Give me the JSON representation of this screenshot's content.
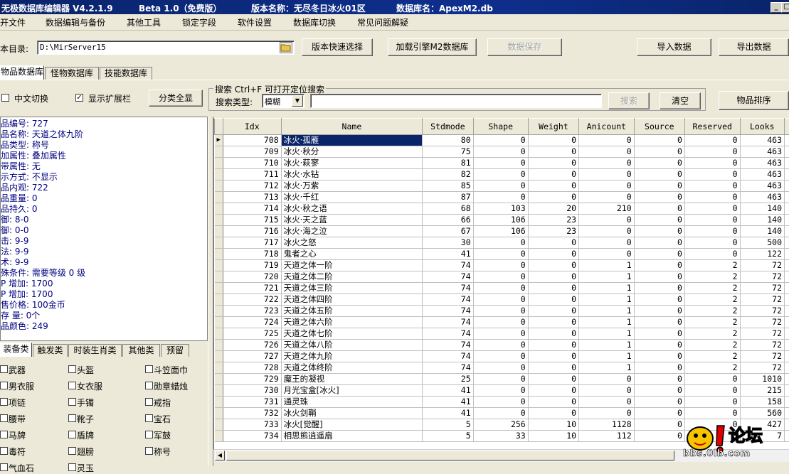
{
  "window": {
    "app_title": "无极数据库编辑器 V4.2.1.9",
    "edition": "Beta 1.0（免费版）",
    "version_name": "版本名称：无尽冬日冰火01区",
    "db_name": "数据库名：ApexM2.db"
  },
  "menu": [
    "开文件",
    "数据编辑与备份",
    "其他工具",
    "锁定字段",
    "软件设置",
    "数据库切换",
    "常见问题解疑"
  ],
  "toolbar": {
    "dir_label": "本目录:",
    "dir_value": "D:\\MirServer15",
    "quick_select": "版本快速选择",
    "load_db": "加载引擎M2数据库",
    "save_data": "数据保存",
    "import_data": "导入数据",
    "export_data": "导出数据"
  },
  "tabs": [
    "物品数据库",
    "怪物数据库",
    "技能数据库"
  ],
  "options": {
    "chinese_switch": "中文切换",
    "show_ext": "显示扩展栏",
    "category_all": "分类全显"
  },
  "search": {
    "group_title": "搜索  Ctrl+F 可打开定位搜索",
    "type_label": "搜索类型:",
    "type_value": "模糊",
    "search_btn": "搜索",
    "clear_btn": "清空",
    "sort_btn": "物品排序"
  },
  "info_lines": [
    "品编号: 727",
    "品名称: 天道之体九阶",
    "品类型: 称号",
    "加属性: 叠加属性",
    "带属性: 无",
    "示方式: 不显示",
    "品内观: 722",
    "品重量: 0",
    "品持久: 0",
    "    御: 8-0",
    "    御: 0-0",
    "    击: 9-9",
    "    法: 9-9",
    "    术: 9-9",
    "殊条件: 需要等级 0 级",
    "P  增加: 1700",
    "P  增加: 1700",
    "售价格: 100金币",
    "存 量: 0个",
    "品颜色: 249"
  ],
  "category_tabs": [
    "装备类",
    "触发类",
    "时装生肖类",
    "其他类",
    "预留"
  ],
  "categories": [
    [
      "武器",
      "头盔",
      "斗笠面巾"
    ],
    [
      "男衣服",
      "女衣服",
      "勋章蜡烛"
    ],
    [
      "项链",
      "手镯",
      "戒指"
    ],
    [
      "腰带",
      "靴子",
      "宝石"
    ],
    [
      "马牌",
      "盾牌",
      "军鼓"
    ],
    [
      "毒符",
      "翅膀",
      "称号"
    ],
    [
      "气血石",
      "灵玉",
      ""
    ]
  ],
  "grid": {
    "columns": [
      "Idx",
      "Name",
      "Stdmode",
      "Shape",
      "Weight",
      "Anicount",
      "Source",
      "Reserved",
      "Looks"
    ],
    "rows": [
      [
        "708",
        "冰火·孤雁",
        "80",
        "0",
        "0",
        "0",
        "0",
        "0",
        "463"
      ],
      [
        "709",
        "冰火·秋分",
        "75",
        "0",
        "0",
        "0",
        "0",
        "0",
        "463"
      ],
      [
        "710",
        "冰火·萩寥",
        "81",
        "0",
        "0",
        "0",
        "0",
        "0",
        "463"
      ],
      [
        "711",
        "冰火·水钻",
        "82",
        "0",
        "0",
        "0",
        "0",
        "0",
        "463"
      ],
      [
        "712",
        "冰火·万紫",
        "85",
        "0",
        "0",
        "0",
        "0",
        "0",
        "463"
      ],
      [
        "713",
        "冰火·千红",
        "87",
        "0",
        "0",
        "0",
        "0",
        "0",
        "463"
      ],
      [
        "714",
        "冰火·秋之语",
        "68",
        "103",
        "20",
        "210",
        "0",
        "0",
        "140"
      ],
      [
        "715",
        "冰火·天之蓝",
        "66",
        "106",
        "23",
        "0",
        "0",
        "0",
        "140"
      ],
      [
        "716",
        "冰火·海之泣",
        "67",
        "106",
        "23",
        "0",
        "0",
        "0",
        "140"
      ],
      [
        "717",
        "冰火之怒",
        "30",
        "0",
        "0",
        "0",
        "0",
        "0",
        "500"
      ],
      [
        "718",
        "鬼者之心",
        "41",
        "0",
        "0",
        "0",
        "0",
        "0",
        "122"
      ],
      [
        "719",
        "天道之体一阶",
        "74",
        "0",
        "0",
        "1",
        "0",
        "2",
        "72"
      ],
      [
        "720",
        "天道之体二阶",
        "74",
        "0",
        "0",
        "1",
        "0",
        "2",
        "72"
      ],
      [
        "721",
        "天道之体三阶",
        "74",
        "0",
        "0",
        "1",
        "0",
        "2",
        "72"
      ],
      [
        "722",
        "天道之体四阶",
        "74",
        "0",
        "0",
        "1",
        "0",
        "2",
        "72"
      ],
      [
        "723",
        "天道之体五阶",
        "74",
        "0",
        "0",
        "1",
        "0",
        "2",
        "72"
      ],
      [
        "724",
        "天道之体六阶",
        "74",
        "0",
        "0",
        "1",
        "0",
        "2",
        "72"
      ],
      [
        "725",
        "天道之体七阶",
        "74",
        "0",
        "0",
        "1",
        "0",
        "2",
        "72"
      ],
      [
        "726",
        "天道之体八阶",
        "74",
        "0",
        "0",
        "1",
        "0",
        "2",
        "72"
      ],
      [
        "727",
        "天道之体九阶",
        "74",
        "0",
        "0",
        "1",
        "0",
        "2",
        "72"
      ],
      [
        "728",
        "天道之体终阶",
        "74",
        "0",
        "0",
        "1",
        "0",
        "2",
        "72"
      ],
      [
        "729",
        "魔王的凝视",
        "25",
        "0",
        "0",
        "0",
        "0",
        "0",
        "1010"
      ],
      [
        "730",
        "月光宝盒[冰火]",
        "41",
        "0",
        "0",
        "0",
        "0",
        "0",
        "215"
      ],
      [
        "731",
        "通灵珠",
        "41",
        "0",
        "0",
        "0",
        "0",
        "0",
        "158"
      ],
      [
        "732",
        "冰火剑鞘",
        "41",
        "0",
        "0",
        "0",
        "0",
        "0",
        "560"
      ],
      [
        "733",
        "冰火[觉醒]",
        "5",
        "256",
        "10",
        "1128",
        "0",
        "0",
        "427"
      ],
      [
        "734",
        "相思熊逍遥扇",
        "5",
        "33",
        "10",
        "112",
        "0",
        "0",
        "7"
      ]
    ]
  },
  "logo": {
    "text": "论坛",
    "url_text": "bbs.0lb.com"
  },
  "colors": {
    "title_bg": "#0a246a",
    "selection": "#0a246a",
    "info_text": "#000080"
  }
}
